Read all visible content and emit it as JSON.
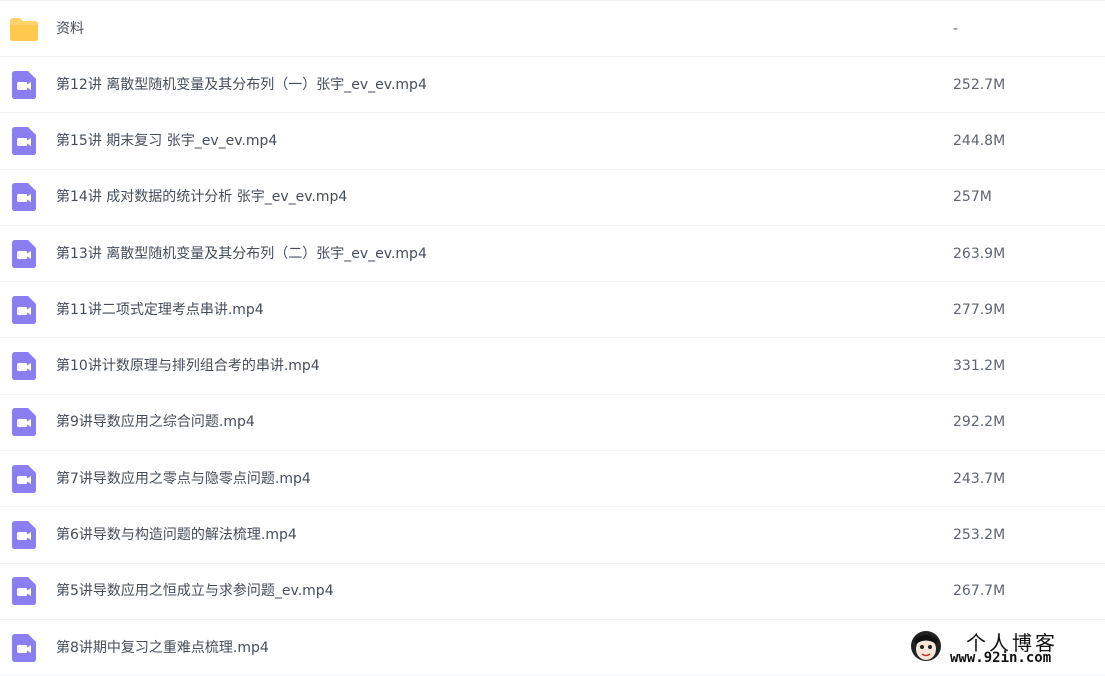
{
  "colors": {
    "folder": "#FFD36B",
    "video_icon_bg": "#8A7EF0",
    "text": "#454d5a",
    "divider": "#f1f2f5"
  },
  "files": [
    {
      "icon": "folder-icon",
      "name": "资料",
      "size": "-"
    },
    {
      "icon": "video-file-icon",
      "name": "第12讲 离散型随机变量及其分布列（一）张宇_ev_ev.mp4",
      "size": "252.7M"
    },
    {
      "icon": "video-file-icon",
      "name": "第15讲 期末复习 张宇_ev_ev.mp4",
      "size": "244.8M"
    },
    {
      "icon": "video-file-icon",
      "name": "第14讲 成对数据的统计分析 张宇_ev_ev.mp4",
      "size": "257M"
    },
    {
      "icon": "video-file-icon",
      "name": "第13讲 离散型随机变量及其分布列（二）张宇_ev_ev.mp4",
      "size": "263.9M"
    },
    {
      "icon": "video-file-icon",
      "name": "第11讲二项式定理考点串讲.mp4",
      "size": "277.9M"
    },
    {
      "icon": "video-file-icon",
      "name": "第10讲计数原理与排列组合考的串讲.mp4",
      "size": "331.2M"
    },
    {
      "icon": "video-file-icon",
      "name": "第9讲导数应用之综合问题.mp4",
      "size": "292.2M"
    },
    {
      "icon": "video-file-icon",
      "name": "第7讲导数应用之零点与隐零点问题.mp4",
      "size": "243.7M"
    },
    {
      "icon": "video-file-icon",
      "name": "第6讲导数与构造问题的解法梳理.mp4",
      "size": "253.2M"
    },
    {
      "icon": "video-file-icon",
      "name": "第5讲导数应用之恒成立与求参问题_ev.mp4",
      "size": "267.7M"
    },
    {
      "icon": "video-file-icon",
      "name": "第8讲期中复习之重难点梳理.mp4",
      "size": ""
    }
  ],
  "watermark": {
    "title": "个人博客",
    "url": "www.92in.com"
  }
}
